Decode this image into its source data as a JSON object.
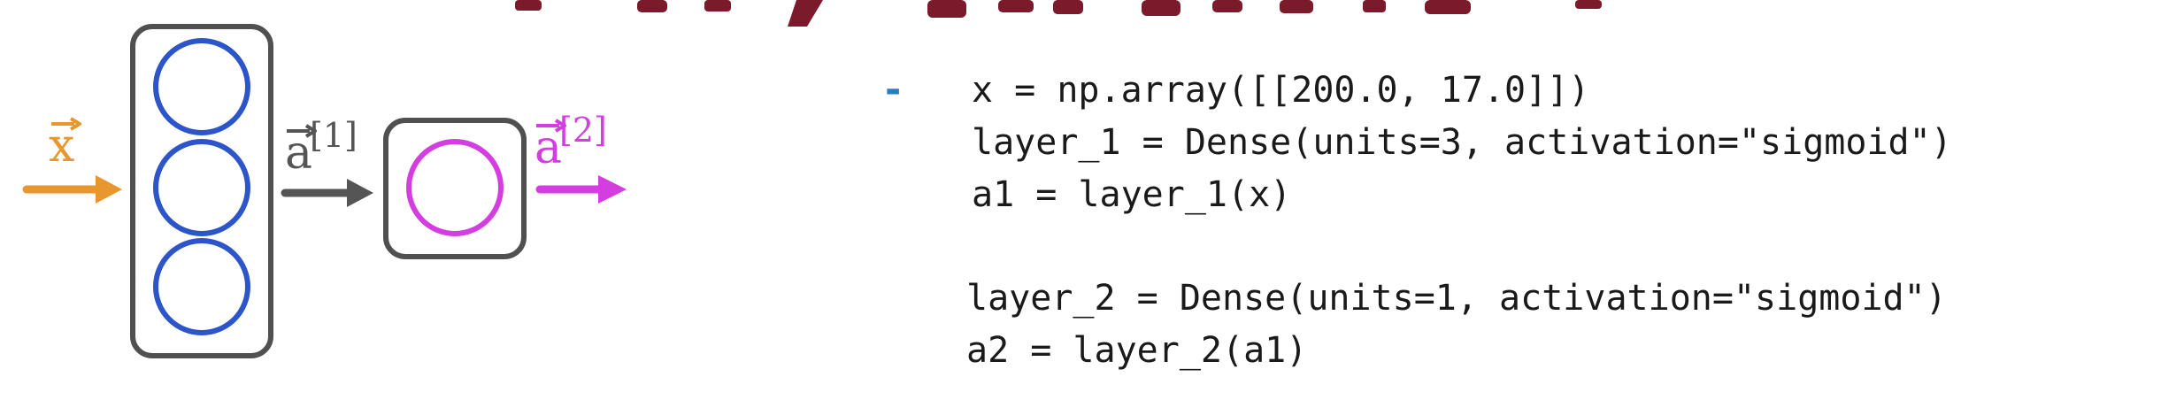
{
  "diagram": {
    "input_label": "x",
    "hidden_output_label": "a",
    "hidden_output_superscript": "[1]",
    "final_output_label": "a",
    "final_output_superscript": "[2]",
    "colors": {
      "input": "#e8962e",
      "layer1_node": "#2b55c8",
      "layer2_node": "#d43ee0",
      "hidden_arrow": "#555555",
      "box_border": "#505050",
      "title_fragment": "#7a1a2a"
    },
    "layer1_units": 3,
    "layer2_units": 1
  },
  "code": {
    "bullet": "-",
    "line1": "x = np.array([[200.0, 17.0]])",
    "line2": "layer_1 = Dense(units=3, activation=\"sigmoid\")",
    "line3": "a1 = layer_1(x)",
    "line4": "layer_2 = Dense(units=1, activation=\"sigmoid\")",
    "line5": "a2 = layer_2(a1)"
  }
}
